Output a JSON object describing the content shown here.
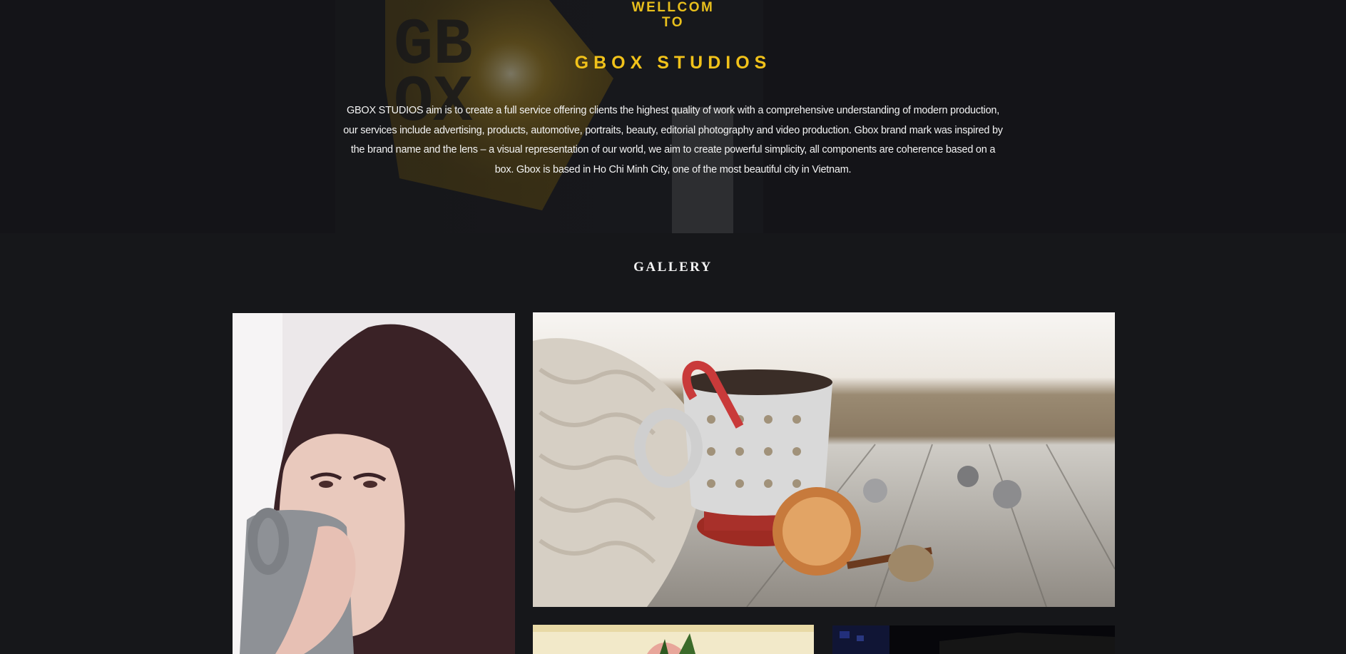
{
  "hero": {
    "welcome_line1": "WELLCOM",
    "welcome_line2": "TO",
    "title": "GBOX STUDIOS",
    "description": "GBOX STUDIOS aim is to create a full service offering clients the highest quality of work with a comprehensive understanding of modern production, our services include advertising, products, automotive, portraits, beauty, editorial photography and video production. Gbox brand mark was inspired by the brand name and the lens – a visual representation of our world, we aim to create powerful simplicity, all components are coherence based on a box. Gbox is based in Ho Chi Minh City, one of the most beautiful city in Vietnam.",
    "sign_text": [
      "GB",
      "OX"
    ]
  },
  "gallery": {
    "title": "GALLERY",
    "photos": [
      {
        "name": "woman-drinking-coffee-photo"
      },
      {
        "name": "coffee-mug-still-life-photo"
      },
      {
        "name": "food-dish-photo"
      },
      {
        "name": "dark-interior-photo"
      }
    ]
  },
  "colors": {
    "accent": "#f1c21a",
    "background": "#16171a",
    "hero_background": "#141518",
    "text": "#f3f3f3"
  }
}
